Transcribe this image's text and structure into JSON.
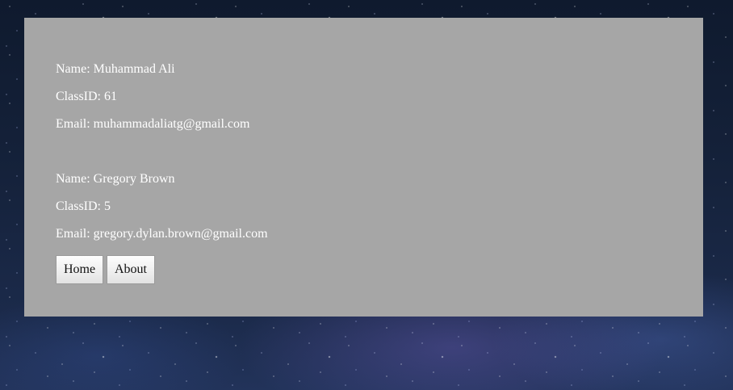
{
  "records": [
    {
      "name": "Name: Muhammad Ali",
      "class_id": "ClassID: 61",
      "email": "Email: muhammadaliatg@gmail.com"
    },
    {
      "name": "Name: Gregory Brown",
      "class_id": "ClassID: 5",
      "email": "Email: gregory.dylan.brown@gmail.com"
    }
  ],
  "nav": {
    "home_label": "Home",
    "about_label": "About"
  },
  "colors": {
    "panel_background": "#a6a6a6",
    "text": "#ffffff",
    "page_background": "#15223b"
  }
}
